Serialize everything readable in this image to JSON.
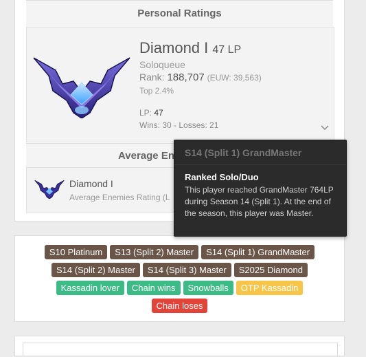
{
  "personal_ratings": {
    "title": "Personal Ratings",
    "tier": "Diamond I",
    "lp_label": "47 LP",
    "queue": "Soloqueue",
    "rank_label": "Rank:",
    "rank_value": "188,707",
    "rank_euw": "(EUW: 39,563)",
    "top_percent": "Top 2.4%",
    "lp_prefix": "LP:",
    "lp_value": "47",
    "wins_losses": "Wins: 30 - Losses: 21"
  },
  "average_enemies": {
    "title": "Average En",
    "tier": "Diamond I",
    "subtitle": "Average Enemies Rating (L"
  },
  "tooltip": {
    "header": "S14 (Split 1) GrandMaster",
    "body_title": "Ranked Solo/Duo",
    "body_text": "This player reached GrandMaster 764LP during Season 14 (Split 1). At the end of the season, this player was Master."
  },
  "tags": {
    "row1": [
      "S10 Platinum",
      "S13 (Split 2) Master",
      "S14 (Split 1) GrandMaster"
    ],
    "row2": [
      "S14 (Split 2) Master",
      "S14 (Split 3) Master",
      "S2025 Diamond"
    ],
    "row3": [
      "Kassadin lover",
      "Chain wins",
      "Snowballs",
      "OTP Kassadin"
    ],
    "row4": [
      "Chain loses"
    ]
  },
  "icons": {
    "rank_emblem": "diamond-emblem-icon",
    "expand": "chevron-down-icon"
  },
  "colors": {
    "tag_brown": "#6b5549",
    "tag_green": "#3dbb86",
    "tag_yellow": "#f7c54a",
    "tag_red": "#e2443a",
    "tooltip_bg": "#2b2b2b"
  }
}
